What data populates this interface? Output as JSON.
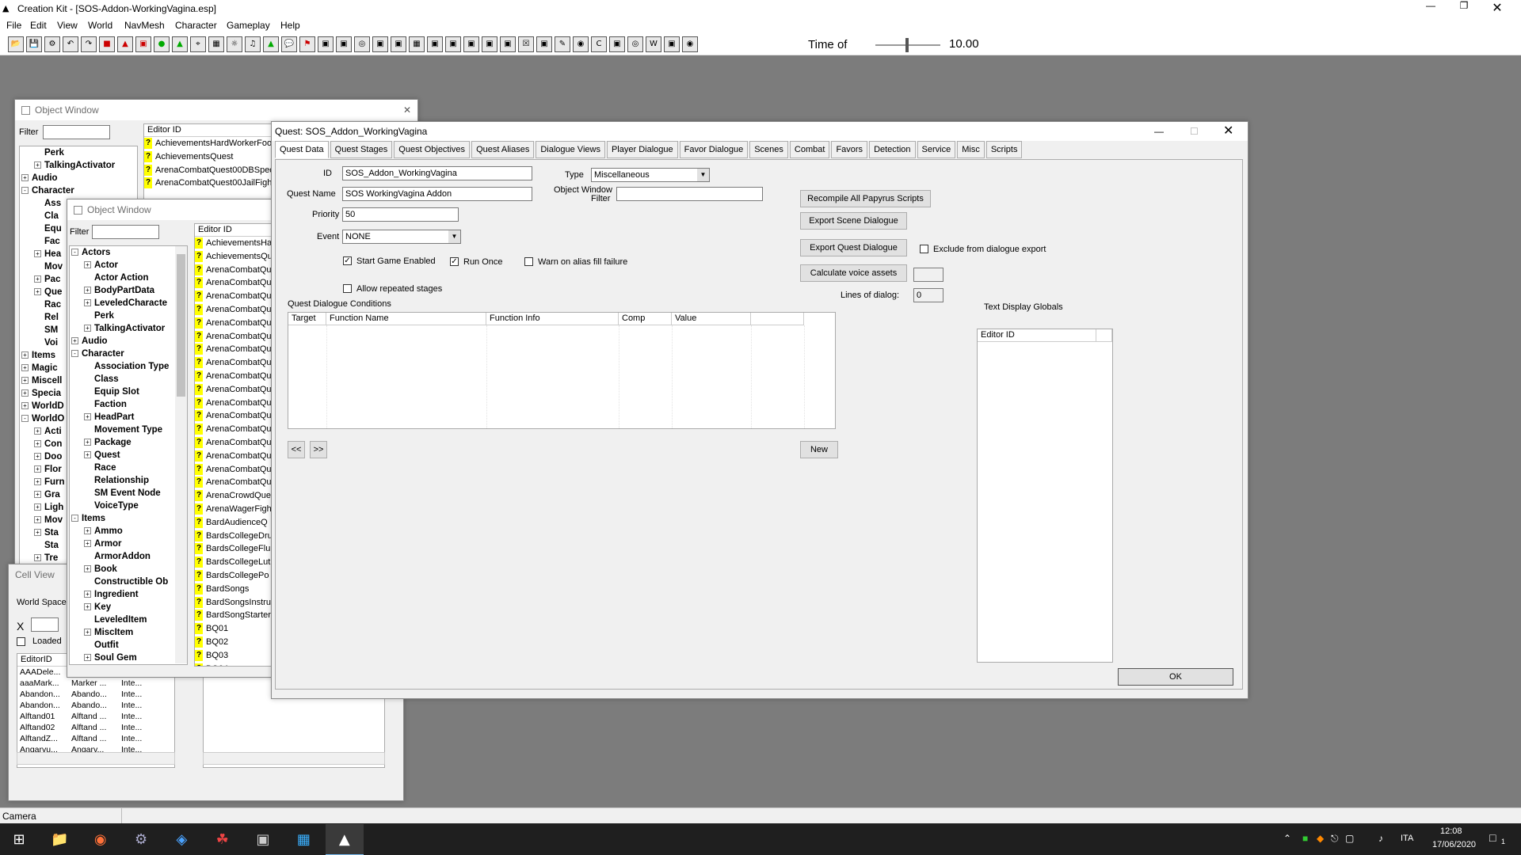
{
  "app": {
    "title": "Creation Kit - [SOS-Addon-WorkingVagina.esp]",
    "menu": [
      "File",
      "Edit",
      "View",
      "World",
      "NavMesh",
      "Character",
      "Gameplay",
      "Help"
    ],
    "time_of_label": "Time of",
    "time_value": "10.00"
  },
  "object_window_back": {
    "title": "Object Window",
    "filter_label": "Filter",
    "col_editor_id": "Editor ID",
    "tree": [
      {
        "label": "Perk",
        "indent": 1
      },
      {
        "label": "TalkingActivator",
        "indent": 1,
        "plus": "+"
      },
      {
        "label": "Audio",
        "indent": 0,
        "plus": "+"
      },
      {
        "label": "Character",
        "indent": 0,
        "plus": "-"
      },
      {
        "label": "Ass",
        "indent": 1
      },
      {
        "label": "Cla",
        "indent": 1
      },
      {
        "label": "Equ",
        "indent": 1
      },
      {
        "label": "Fac",
        "indent": 1
      },
      {
        "label": "Hea",
        "indent": 1,
        "plus": "+"
      },
      {
        "label": "Mov",
        "indent": 1
      },
      {
        "label": "Pac",
        "indent": 1,
        "plus": "+"
      },
      {
        "label": "Que",
        "indent": 1,
        "plus": "+"
      },
      {
        "label": "Rac",
        "indent": 1
      },
      {
        "label": "Rel",
        "indent": 1
      },
      {
        "label": "SM",
        "indent": 1
      },
      {
        "label": "Voi",
        "indent": 1
      },
      {
        "label": "Items",
        "indent": 0,
        "plus": "+"
      },
      {
        "label": "Magic",
        "indent": 0,
        "plus": "+"
      },
      {
        "label": "Miscell",
        "indent": 0,
        "plus": "+"
      },
      {
        "label": "Specia",
        "indent": 0,
        "plus": "+"
      },
      {
        "label": "WorldD",
        "indent": 0,
        "plus": "+"
      },
      {
        "label": "WorldO",
        "indent": 0,
        "plus": "-"
      },
      {
        "label": "Acti",
        "indent": 1,
        "plus": "+"
      },
      {
        "label": "Con",
        "indent": 1,
        "plus": "+"
      },
      {
        "label": "Doo",
        "indent": 1,
        "plus": "+"
      },
      {
        "label": "Flor",
        "indent": 1,
        "plus": "+"
      },
      {
        "label": "Furn",
        "indent": 1,
        "plus": "+"
      },
      {
        "label": "Gra",
        "indent": 1,
        "plus": "+"
      },
      {
        "label": "Ligh",
        "indent": 1,
        "plus": "+"
      },
      {
        "label": "Mov",
        "indent": 1,
        "plus": "+"
      },
      {
        "label": "Sta",
        "indent": 1,
        "plus": "+"
      },
      {
        "label": "Sta",
        "indent": 1
      },
      {
        "label": "Tre",
        "indent": 1,
        "plus": "+"
      }
    ],
    "list": [
      "AchievementsHardWorkerFoo",
      "AchievementsQuest",
      "ArenaCombatQuest00DBSpec",
      "ArenaCombatQuest00JailFight"
    ]
  },
  "object_window_front": {
    "title": "Object Window",
    "filter_label": "Filter",
    "col_editor_id": "Editor ID",
    "tree": [
      {
        "label": "Actors",
        "indent": 0,
        "plus": "-"
      },
      {
        "label": "Actor",
        "indent": 1,
        "plus": "+"
      },
      {
        "label": "Actor Action",
        "indent": 1
      },
      {
        "label": "BodyPartData",
        "indent": 1,
        "plus": "+"
      },
      {
        "label": "LeveledCharacte",
        "indent": 1,
        "plus": "+"
      },
      {
        "label": "Perk",
        "indent": 1
      },
      {
        "label": "TalkingActivator",
        "indent": 1,
        "plus": "+"
      },
      {
        "label": "Audio",
        "indent": 0,
        "plus": "+"
      },
      {
        "label": "Character",
        "indent": 0,
        "plus": "-"
      },
      {
        "label": "Association Type",
        "indent": 1
      },
      {
        "label": "Class",
        "indent": 1
      },
      {
        "label": "Equip Slot",
        "indent": 1
      },
      {
        "label": "Faction",
        "indent": 1
      },
      {
        "label": "HeadPart",
        "indent": 1,
        "plus": "+"
      },
      {
        "label": "Movement Type",
        "indent": 1
      },
      {
        "label": "Package",
        "indent": 1,
        "plus": "+"
      },
      {
        "label": "Quest",
        "indent": 1,
        "plus": "+"
      },
      {
        "label": "Race",
        "indent": 1
      },
      {
        "label": "Relationship",
        "indent": 1
      },
      {
        "label": "SM Event Node",
        "indent": 1
      },
      {
        "label": "VoiceType",
        "indent": 1
      },
      {
        "label": "Items",
        "indent": 0,
        "plus": "-"
      },
      {
        "label": "Ammo",
        "indent": 1,
        "plus": "+"
      },
      {
        "label": "Armor",
        "indent": 1,
        "plus": "+"
      },
      {
        "label": "ArmorAddon",
        "indent": 1
      },
      {
        "label": "Book",
        "indent": 1,
        "plus": "+"
      },
      {
        "label": "Constructible Ob",
        "indent": 1
      },
      {
        "label": "Ingredient",
        "indent": 1,
        "plus": "+"
      },
      {
        "label": "Key",
        "indent": 1,
        "plus": "+"
      },
      {
        "label": "LeveledItem",
        "indent": 1
      },
      {
        "label": "MiscItem",
        "indent": 1,
        "plus": "+"
      },
      {
        "label": "Outfit",
        "indent": 1
      },
      {
        "label": "Soul Gem",
        "indent": 1,
        "plus": "+"
      }
    ],
    "list": [
      "AchievementsHa",
      "AchievementsQu",
      "ArenaCombatQu",
      "ArenaCombatQu",
      "ArenaCombatQu",
      "ArenaCombatQu",
      "ArenaCombatQu",
      "ArenaCombatQu",
      "ArenaCombatQu",
      "ArenaCombatQu",
      "ArenaCombatQu",
      "ArenaCombatQu",
      "ArenaCombatQu",
      "ArenaCombatQu",
      "ArenaCombatQu",
      "ArenaCombatQu",
      "ArenaCombatQu",
      "ArenaCombatQu",
      "ArenaCombatQu",
      "ArenaCrowdQue",
      "ArenaWagerFigh",
      "BardAudienceQ",
      "BardsCollegeDru",
      "BardsCollegeFlu",
      "BardsCollegeLut",
      "BardsCollegePo",
      "BardSongs",
      "BardSongsInstru",
      "BardSongStarter",
      "BQ01",
      "BQ02",
      "BQ03",
      "BQ04"
    ]
  },
  "cell_view": {
    "title": "Cell View",
    "world_space_label": "World Space",
    "x_label": "X",
    "loaded_label": "Loaded",
    "col_editor_id": "EditorID",
    "rows": [
      [
        "AAADele...",
        "",
        ""
      ],
      [
        "aaaMark...",
        "Marker ...",
        "Inte..."
      ],
      [
        "Abandon...",
        "Abando...",
        "Inte..."
      ],
      [
        "Abandon...",
        "Abando...",
        "Inte..."
      ],
      [
        "Alftand01",
        "Alftand ...",
        "Inte..."
      ],
      [
        "Alftand02",
        "Alftand ...",
        "Inte..."
      ],
      [
        "AlftandZ...",
        "Alftand ...",
        "Inte..."
      ],
      [
        "Angarvu...",
        "Angarv...",
        "Inte..."
      ]
    ]
  },
  "quest": {
    "title": "Quest: SOS_Addon_WorkingVagina",
    "tabs": [
      "Quest Data",
      "Quest Stages",
      "Quest Objectives",
      "Quest Aliases",
      "Dialogue Views",
      "Player Dialogue",
      "Favor Dialogue",
      "Scenes",
      "Combat",
      "Favors",
      "Detection",
      "Service",
      "Misc",
      "Scripts"
    ],
    "id_label": "ID",
    "id_value": "SOS_Addon_WorkingVagina",
    "name_label": "Quest Name",
    "name_value": "SOS WorkingVagina Addon",
    "priority_label": "Priority",
    "priority_value": "50",
    "event_label": "Event",
    "event_value": "NONE",
    "type_label": "Type",
    "type_value": "Miscellaneous",
    "ow_filter_label_1": "Object Window",
    "ow_filter_label_2": "Filter",
    "start_game_enabled": "Start Game Enabled",
    "run_once": "Run Once",
    "warn_alias": "Warn on alias fill failure",
    "allow_repeated": "Allow repeated stages",
    "btn_recompile": "Recompile All Papyrus Scripts",
    "btn_export_scene": "Export Scene Dialogue",
    "btn_export_quest": "Export Quest Dialogue",
    "exclude_label": "Exclude from dialogue export",
    "btn_calc_voice": "Calculate voice assets",
    "lines_label": "Lines of dialog:",
    "lines_value": "0",
    "conditions_label": "Quest Dialogue Conditions",
    "cond_cols": [
      "Target",
      "Function Name",
      "Function Info",
      "Comp",
      "Value",
      ""
    ],
    "prev_label": "<<",
    "next_label": ">>",
    "btn_new": "New",
    "text_display_label": "Text Display Globals",
    "tdg_col": "Editor ID",
    "btn_ok": "OK"
  },
  "status": {
    "text": "Camera"
  },
  "taskbar": {
    "lang": "ITA",
    "time": "12:08",
    "date": "17/06/2020",
    "notif": "1"
  }
}
